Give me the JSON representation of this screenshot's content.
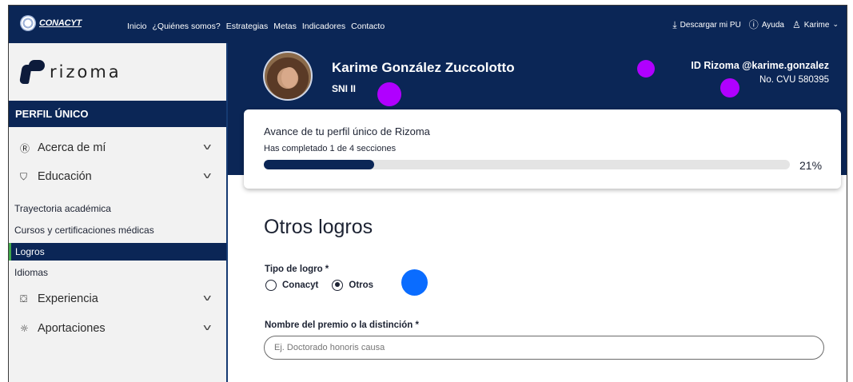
{
  "topnav": {
    "logo_text": "CONACYT",
    "links": [
      "Inicio",
      "¿Quiénes somos?",
      "Estrategias",
      "Metas",
      "Indicadores",
      "Contacto"
    ],
    "download_label": "Descargar mi PU",
    "help_label": "Ayuda",
    "user_label": "Karime",
    "icons": {
      "download": "download-icon",
      "help": "help-icon",
      "user": "user-icon",
      "chevron": "chevron-down-icon"
    }
  },
  "sidebar": {
    "brand": "rizoma",
    "section_header": "PERFIL ÚNICO",
    "menu": [
      {
        "label": "Acerca de mí",
        "icon": "profile-icon"
      },
      {
        "label": "Educación",
        "icon": "graduation-cap-icon"
      },
      {
        "label": "Experiencia",
        "icon": "briefcase-icon"
      },
      {
        "label": "Aportaciones",
        "icon": "lightbulb-icon"
      }
    ],
    "education_items": [
      {
        "label": "Trayectoria académica",
        "active": false
      },
      {
        "label": "Cursos y certificaciones médicas",
        "active": false
      },
      {
        "label": "Logros",
        "active": true
      },
      {
        "label": "Idiomas",
        "active": false
      }
    ]
  },
  "profile": {
    "name": "Karime González Zuccolotto",
    "level": "SNI II",
    "rizoma_id": "ID Rizoma @karime.gonzalez",
    "cvu": "No. CVU 580395"
  },
  "progress": {
    "title": "Avance de tu perfil único de Rizoma",
    "subtitle": "Has completado 1 de 4 secciones",
    "percent_value": 21,
    "percent_label": "21%"
  },
  "form": {
    "title": "Otros logros",
    "type_label": "Tipo de logro *",
    "options": [
      "Conacyt",
      "Otros"
    ],
    "selected_option": "Otros",
    "award_label": "Nombre del premio o la distinción *",
    "award_placeholder": "Ej. Doctorado honoris causa",
    "award_value": ""
  },
  "colors": {
    "navy": "#0b2656",
    "marker_purple": "#b000ff",
    "marker_blue": "#0a6cff",
    "active_accent": "#3fa84a"
  }
}
